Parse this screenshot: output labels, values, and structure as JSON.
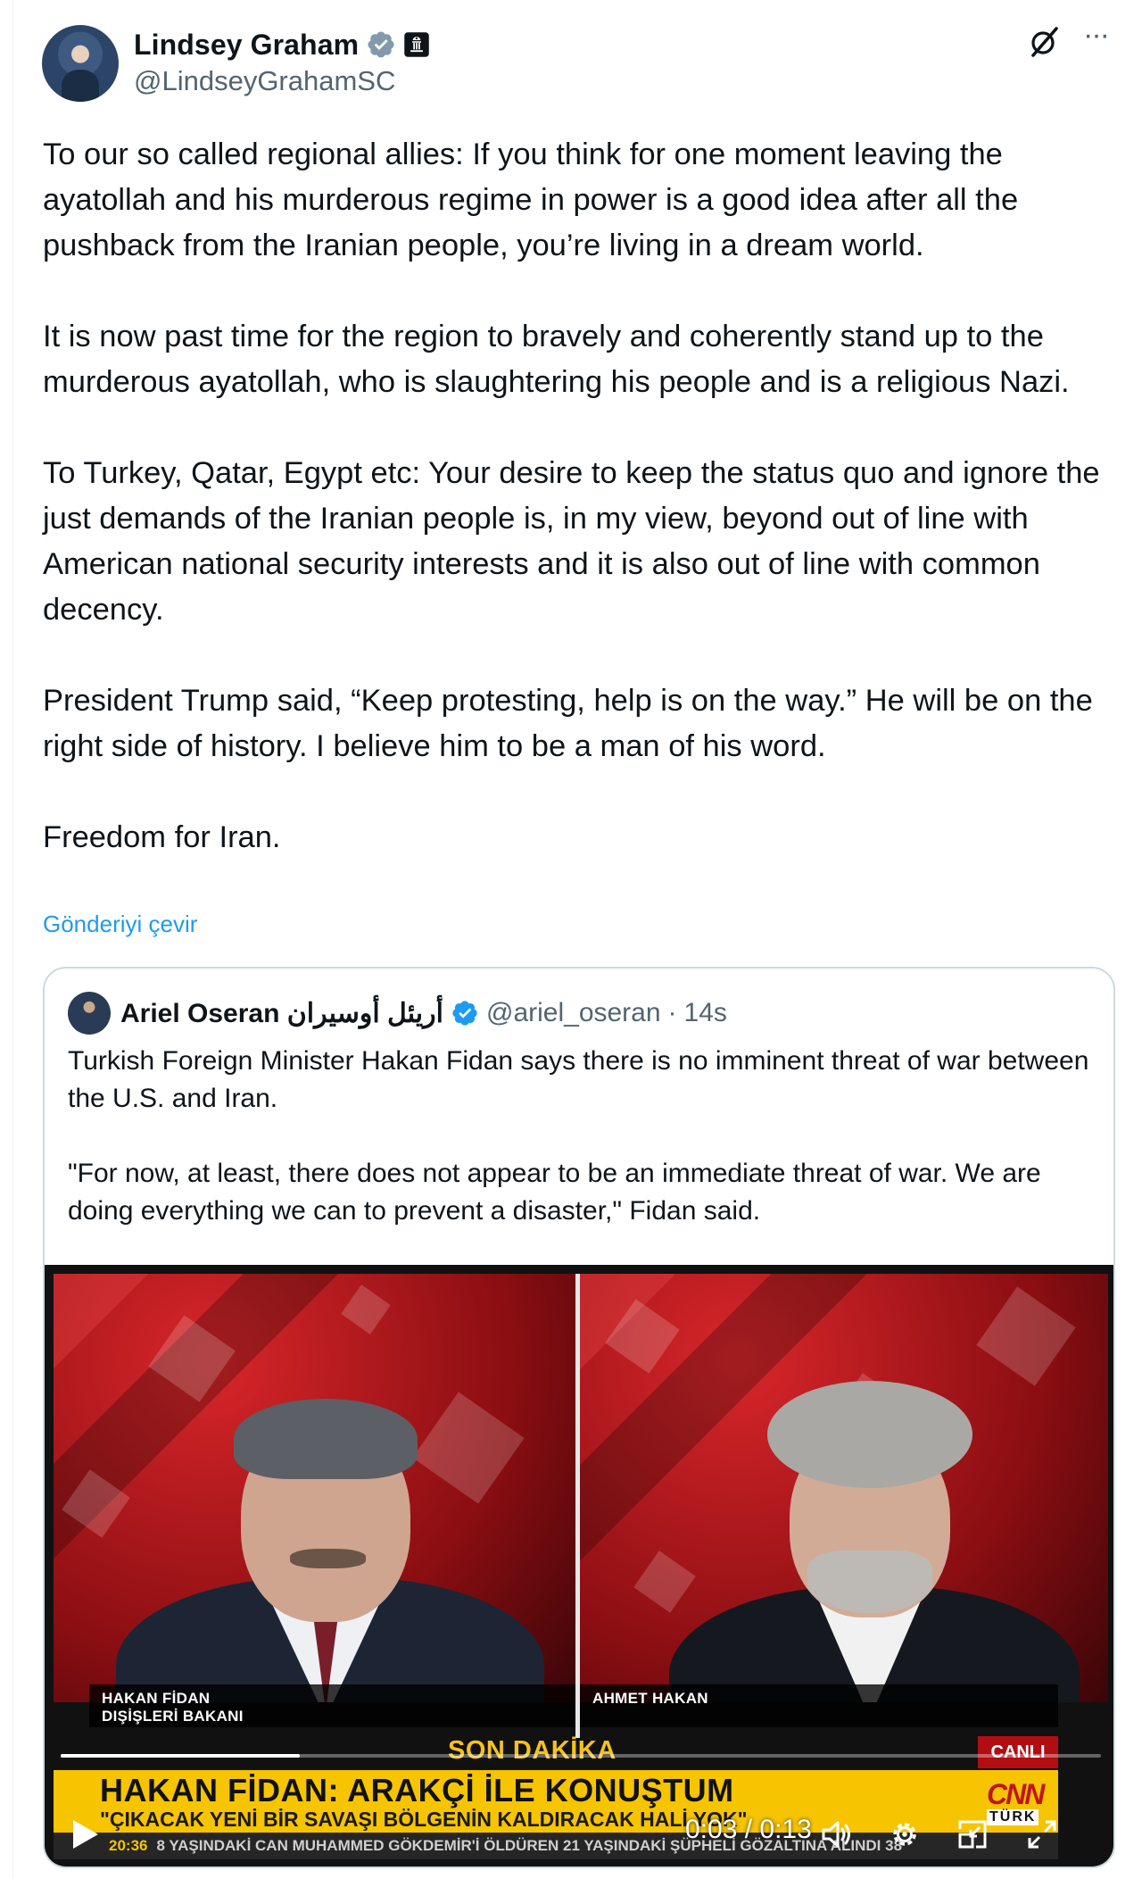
{
  "author": {
    "display_name": "Lindsey Graham",
    "handle": "@LindseyGrahamSC",
    "verified_icon": "verified-badge-icon",
    "affiliation_icon": "government-badge-icon"
  },
  "actions": {
    "grok_icon": "grok-icon",
    "more_label": "···"
  },
  "tweet": {
    "paragraphs": [
      "To our so called regional allies: If you think for one moment leaving the ayatollah and his murderous regime in power is a good idea after all the pushback from the Iranian people, you’re living in a dream world.",
      "It is now past time for the region to bravely and coherently stand up to the murderous ayatollah, who is slaughtering his people and is a religious Nazi.",
      "To Turkey, Qatar, Egypt etc: Your desire to keep the status quo and ignore the just demands of the Iranian people is, in my view, beyond out of line with American national security interests and it is also out of line with common decency.",
      "President Trump said, “Keep protesting, help is on the way.” He will be on the right side of history. I believe him to be a man of his word.",
      "Freedom for Iran."
    ],
    "translate_label": "Gönderiyi çevir"
  },
  "quote": {
    "display_name": "Ariel Oseran أريئل أوسيران",
    "handle": "@ariel_oseran",
    "separator": "·",
    "time": "14s",
    "paragraphs": [
      "Turkish Foreign Minister Hakan Fidan says there is no imminent threat of war between the U.S. and Iran.",
      "\"For now, at least, there does not appear to be an immediate threat of war. We are doing everything we can to prevent a disaster,\" Fidan said."
    ]
  },
  "video": {
    "left_caption_line1": "HAKAN FİDAN",
    "left_caption_line2": "DIŞİŞLERİ BAKANI",
    "right_caption": "AHMET HAKAN",
    "breaking_label": "SON DAKİKA",
    "live_label": "CANLI",
    "headline": "HAKAN FİDAN: ARAKÇİ İLE KONUŞTUM",
    "subheadline": "\"ÇIKACAK YENİ BİR SAVAŞI BÖLGENİN KALDIRACAK HALİ YOK\"",
    "ticker_time": "20:36",
    "ticker_text": "8 YAŞINDAKİ CAN MUHAMMED GÖKDEMİR'İ ÖLDÜREN 21 YAŞINDAKİ ŞÜPHELİ GÖZALTINA ALINDI   38",
    "channel_logo": "CNN",
    "channel_sub": "TÜRK",
    "current_time": "0:03",
    "duration": "0:13",
    "time_display": "0:03 / 0:13",
    "progress_fraction": 0.23,
    "controls": [
      "play-icon",
      "volume-icon",
      "settings-icon",
      "minimize-icon",
      "fullscreen-icon"
    ]
  },
  "colors": {
    "link": "#1d9bf0",
    "secondary_text": "#536471",
    "verified": "#1d9bf0",
    "ticker_yellow": "#f6c400",
    "cnn_red": "#c0151b"
  }
}
